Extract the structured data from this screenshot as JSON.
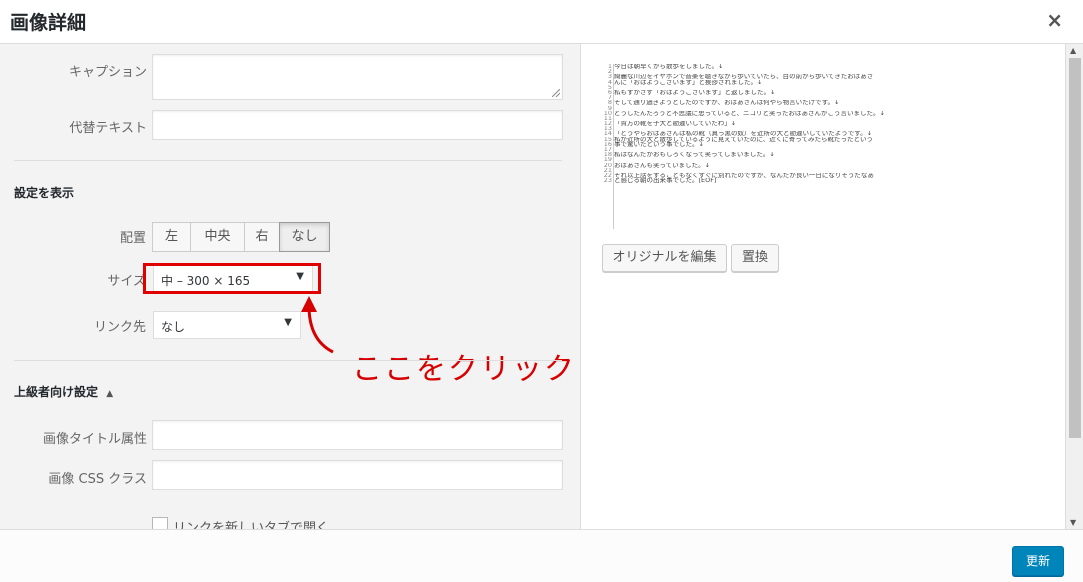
{
  "header": {
    "title": "画像詳細",
    "close_icon": "×"
  },
  "form": {
    "caption_label": "キャプション",
    "alt_label": "代替テキスト",
    "display_section": "設定を表示",
    "align_label": "配置",
    "align_options": [
      "左",
      "中央",
      "右",
      "なし"
    ],
    "align_selected": "なし",
    "size_label": "サイズ",
    "size_value": "中 – 300 × 165",
    "link_label": "リンク先",
    "link_value": "なし",
    "advanced_section": "上級者向け設定",
    "advanced_toggle": "▲",
    "image_title_label": "画像タイトル属性",
    "css_class_label": "画像 CSS クラス",
    "new_tab_label": "リンクを新しいタブで開く"
  },
  "annotation": {
    "text": "ここをクリック",
    "color": "#d60000"
  },
  "preview": {
    "lines": [
      {
        "n": "1",
        "t": "今日は朝早くから散歩をしました。↓"
      },
      {
        "n": "2",
        "t": ""
      },
      {
        "n": "3",
        "t": "綺麗な川辺をイヤホンで音楽を聴きながら歩いていたら、目の前から歩いてきたおばあさ"
      },
      {
        "n": "4",
        "t": "んに「おはようございます」と挨拶されました。↓"
      },
      {
        "n": "5",
        "t": ""
      },
      {
        "n": "6",
        "t": "私もすかさず「おはようございます」と返しました。↓"
      },
      {
        "n": "7",
        "t": ""
      },
      {
        "n": "8",
        "t": "そして通り過ぎようとしたのですが、おばあさんは何やら物言いたげです。↓"
      },
      {
        "n": "9",
        "t": ""
      },
      {
        "n": "10",
        "t": "どうしたんだろうと不思議に思っていると、ニコリと笑ったおばあさんがこう言いました。↓"
      },
      {
        "n": "11",
        "t": ""
      },
      {
        "n": "12",
        "t": "「貴方の靴を子犬と勘違いしていたわ」↓"
      },
      {
        "n": "13",
        "t": ""
      },
      {
        "n": "14",
        "t": "「どうやらおばあさんは私の靴（真っ黒の奴）を近所の犬と勘違いしていたようです。↓"
      },
      {
        "n": "15",
        "t": "私が近所の犬と散歩しているように見えていたのに、近くに寄ってみたら靴だったという"
      },
      {
        "n": "16",
        "t": "事で驚いたという事でした。↓"
      },
      {
        "n": "17",
        "t": ""
      },
      {
        "n": "18",
        "t": "私はなんだかおもしろくなって笑ってしまいました。↓"
      },
      {
        "n": "19",
        "t": ""
      },
      {
        "n": "20",
        "t": "おばあさんも笑っていました。↓"
      },
      {
        "n": "21",
        "t": ""
      },
      {
        "n": "22",
        "t": "それ以上話をすることもなくすぐに別れたのですが、なんだか良い一日になりそうだなあ"
      },
      {
        "n": "23",
        "t": "と感じる朝の出来事でした。[EOF]"
      }
    ],
    "edit_original": "オリジナルを編集",
    "replace": "置換"
  },
  "footer": {
    "update": "更新"
  },
  "colors": {
    "primary": "#0085ba",
    "highlight": "#e00000"
  }
}
